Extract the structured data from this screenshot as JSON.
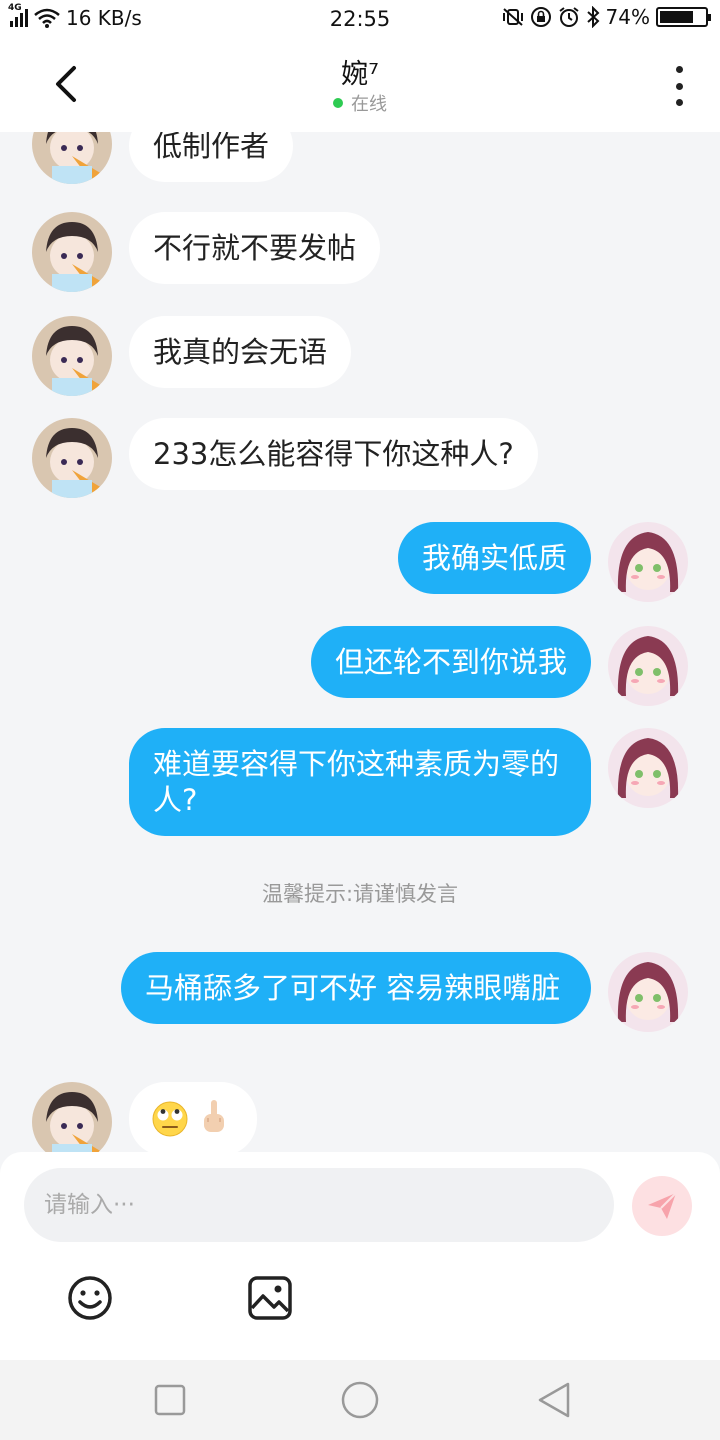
{
  "status": {
    "network": "4G",
    "speed": "16 KB/s",
    "time": "22:55",
    "battery": "74%",
    "battery_level": 0.74
  },
  "header": {
    "title": "婉⁷",
    "presence": "在线",
    "presence_color": "#2ecb52"
  },
  "chat": {
    "bubble_in_color": "#ffffff",
    "bubble_out_color": "#1fb0f7",
    "messages": [
      {
        "side": "in",
        "text": "低制作者"
      },
      {
        "side": "in",
        "text": "不行就不要发帖"
      },
      {
        "side": "in",
        "text": "我真的会无语"
      },
      {
        "side": "in",
        "text": "233怎么能容得下你这种人?"
      },
      {
        "side": "out",
        "text": "我确实低质"
      },
      {
        "side": "out",
        "text": "但还轮不到你说我"
      },
      {
        "side": "out",
        "text": "难道要容得下你这种素质为零的人?"
      },
      {
        "side": "out",
        "text": "马桶舔多了可不好 容易辣眼嘴脏"
      },
      {
        "side": "in",
        "text": "🙄🖕",
        "icons": [
          "eye-roll-emoji-icon",
          "middle-finger-emoji-icon"
        ]
      }
    ],
    "system_notice": "温馨提示:请谨慎发言"
  },
  "composer": {
    "placeholder": "请输入···",
    "send_icon": "paper-plane-icon",
    "tools": [
      "smiley-icon",
      "image-icon"
    ]
  },
  "navbar": {
    "buttons": [
      "square-recents-icon",
      "circle-home-icon",
      "triangle-back-icon"
    ]
  }
}
